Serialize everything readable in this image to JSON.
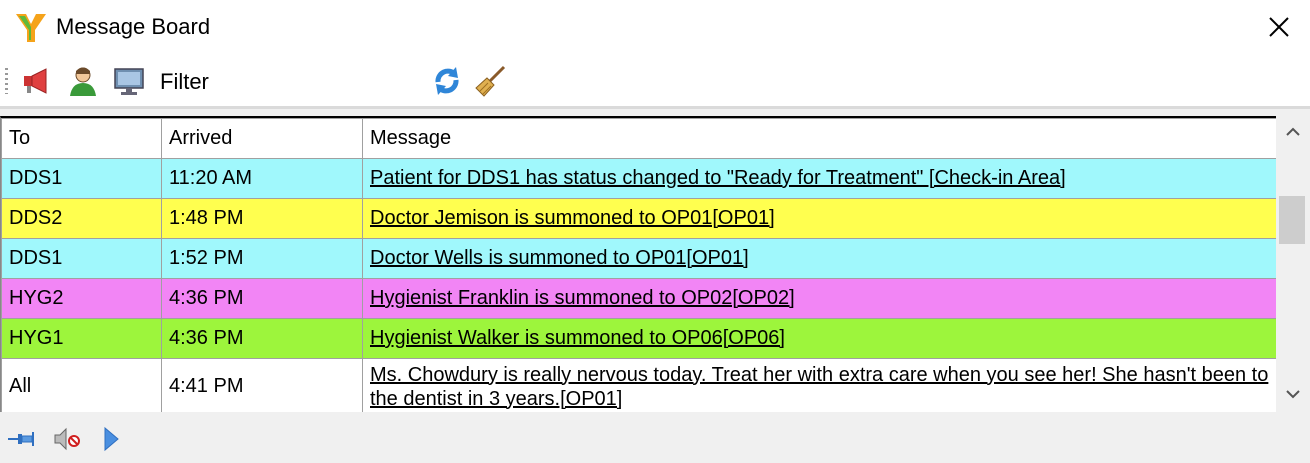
{
  "window": {
    "title": "Message Board",
    "icons": {
      "app": "y-logo-icon",
      "close": "close-icon"
    }
  },
  "toolbar": {
    "filter_label": "Filter",
    "filter_value": "",
    "icons": [
      "megaphone-icon",
      "person-icon",
      "monitor-icon",
      "refresh-icon",
      "broom-icon"
    ]
  },
  "grid": {
    "columns": [
      "To",
      "Arrived",
      "Message"
    ],
    "rows": [
      {
        "to": "DDS1",
        "arrived": "11:20 AM",
        "message": "Patient for DDS1 has status changed to \"Ready for Treatment\" [Check-in Area]",
        "color": "#a0f8fc"
      },
      {
        "to": "DDS2",
        "arrived": "1:48 PM",
        "message": "Doctor Jemison is summoned to OP01[OP01]",
        "color": "#ffff4f"
      },
      {
        "to": "DDS1",
        "arrived": "1:52 PM",
        "message": "Doctor Wells is summoned to OP01[OP01]",
        "color": "#a0f8fc"
      },
      {
        "to": "HYG2",
        "arrived": "4:36 PM",
        "message": "Hygienist Franklin is summoned to OP02[OP02]",
        "color": "#f285f5"
      },
      {
        "to": "HYG1",
        "arrived": "4:36 PM",
        "message": "Hygienist Walker is summoned to OP06[OP06]",
        "color": "#9df53c"
      },
      {
        "to": "All",
        "arrived": "4:41 PM",
        "message": "Ms. Chowdury is really nervous today.  Treat her with extra care when you see her!  She hasn't been to the dentist in 3 years.[OP01]",
        "color": "#ffffff"
      }
    ]
  },
  "statusbar": {
    "icons": [
      "pin-icon",
      "mute-icon",
      "play-icon"
    ]
  }
}
